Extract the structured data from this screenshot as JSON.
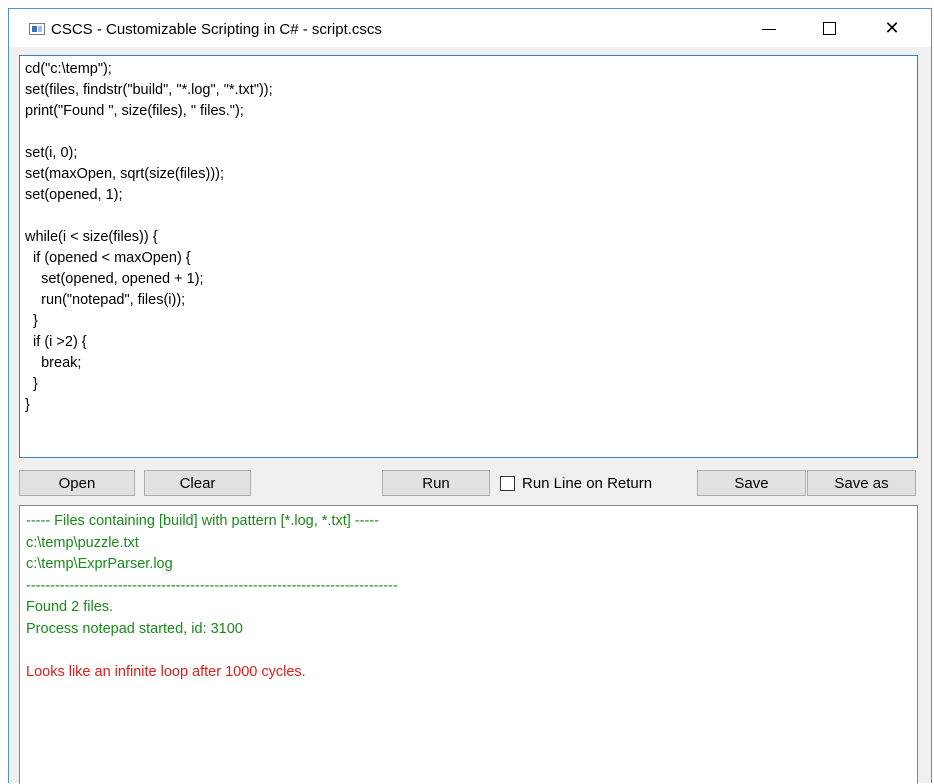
{
  "window": {
    "title": "CSCS - Customizable Scripting in C# - script.cscs",
    "close_glyph": "✕"
  },
  "editor": {
    "lines": [
      "cd(\"c:\\temp\");",
      "set(files, findstr(\"build\", \"*.log\", \"*.txt\"));",
      "print(\"Found \", size(files), \" files.\");",
      "",
      "set(i, 0);",
      "set(maxOpen, sqrt(size(files)));",
      "set(opened, 1);",
      "",
      "while(i < size(files)) {",
      "  if (opened < maxOpen) {",
      "    set(opened, opened + 1);",
      "    run(\"notepad\", files(i));",
      "  }",
      "  if (i >2) {",
      "    break;",
      "  }",
      "}"
    ]
  },
  "toolbar": {
    "open_label": "Open",
    "clear_label": "Clear",
    "run_label": "Run",
    "run_line_label": "Run Line on Return",
    "run_line_checked": false,
    "save_label": "Save",
    "save_as_label": "Save as"
  },
  "output": {
    "lines": [
      {
        "text": "----- Files containing [build] with pattern [*.log, *.txt] -----",
        "color": "#1a8a1a"
      },
      {
        "text": "c:\\temp\\puzzle.txt",
        "color": "#1a8a1a"
      },
      {
        "text": "c:\\temp\\ExprParser.log",
        "color": "#1a8a1a"
      },
      {
        "text": "-----------------------------------------------------------------------------",
        "color": "#1a8a1a"
      },
      {
        "text": "Found 2 files.",
        "color": "#1a8a1a"
      },
      {
        "text": "Process notepad started, id: 3100",
        "color": "#1a8a1a"
      },
      {
        "text": "",
        "color": "#1a8a1a"
      },
      {
        "text": "Looks like an infinite loop after 1000 cycles.",
        "color": "#e01b1b"
      }
    ]
  }
}
